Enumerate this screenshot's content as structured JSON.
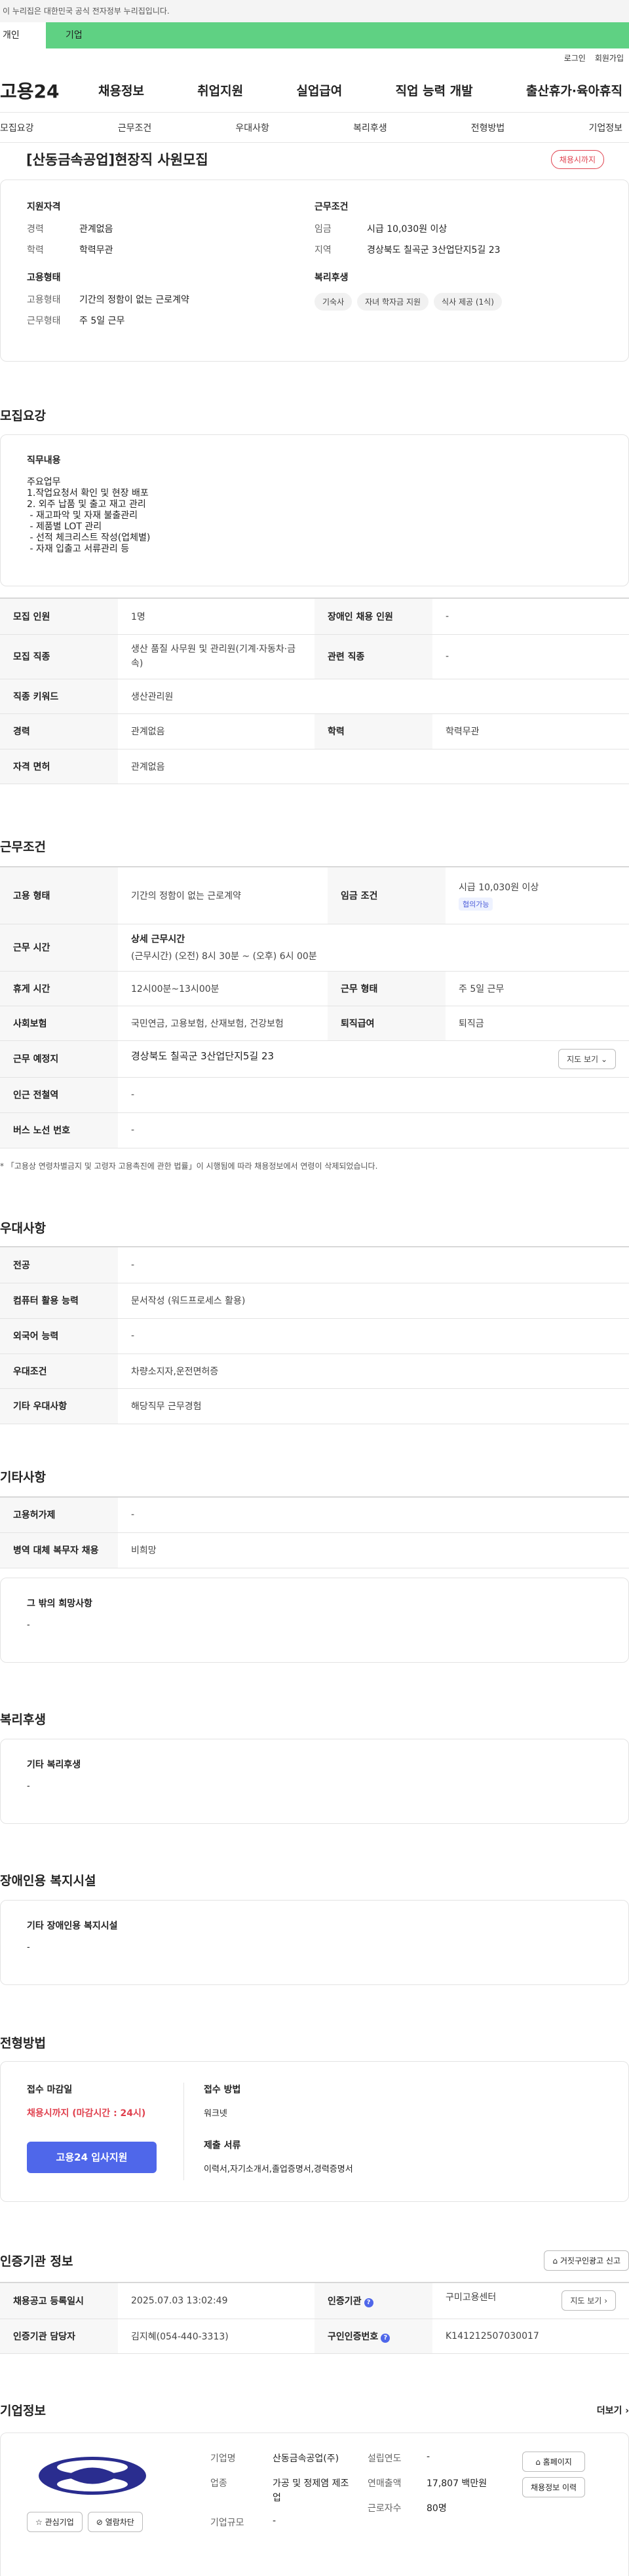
{
  "gov_banner": "이 누리집은 대한민국 공식 전자정부 누리집입니다.",
  "user_tabs": [
    "개인",
    "기업"
  ],
  "util": [
    "로그인",
    "회원가입"
  ],
  "logo": "고용24",
  "gnb": [
    "채용정보",
    "취업지원",
    "실업급여",
    "직업 능력 개발",
    "출산휴가·육아휴직"
  ],
  "anchor_tabs": [
    "모집요강",
    "근무조건",
    "우대사항",
    "복리후생",
    "전형방법",
    "기업정보"
  ],
  "summary": {
    "title": "[산동금속공업]현장직 사원모집",
    "badge": "채용시까지",
    "qual_title": "지원자격",
    "qual_rows": [
      {
        "k": "경력",
        "v": "관계없음"
      },
      {
        "k": "학력",
        "v": "학력무관"
      }
    ],
    "emp_title": "고용형태",
    "emp_rows": [
      {
        "k": "고용형태",
        "v": "기간의 정함이 없는 근로계약"
      },
      {
        "k": "근무형태",
        "v": "주 5일 근무"
      }
    ],
    "cond_title": "근무조건",
    "cond_rows": [
      {
        "k": "임금",
        "v": "시급 10,030원 이상"
      },
      {
        "k": "지역",
        "v": "경상북도 칠곡군 3산업단지5길 23"
      }
    ],
    "welfare_title": "복리후생",
    "welfare_chips": [
      "기숙사",
      "자녀 학자금 지원",
      "식사 제공 (1식)"
    ]
  },
  "recruit": {
    "title": "모집요강",
    "job_title": "직무내용",
    "job_text": "주요업무\n1.작업요청서 확인 및 현장 배포\n2. 외주 납품 및 출고 재고 관리\n - 재고파악 및 자재 불출관리\n - 제품별 LOT 관리\n - 선적 체크리스트 작성(업체별)\n - 자재 입출고 서류관리 등",
    "rows": [
      {
        "k1": "모집 인원",
        "v1": "1명",
        "k2": "장애인 채용 인원",
        "v2": "-"
      },
      {
        "k1": "모집 직종",
        "v1": "생산 품질 사무원 및 관리원(기계·자동차·금속)",
        "k2": "관련 직종",
        "v2": "-"
      },
      {
        "k1": "직종 키워드",
        "v1": "생산관리원"
      },
      {
        "k1": "경력",
        "v1": "관계없음",
        "k2": "학력",
        "v2": "학력무관"
      },
      {
        "k1": "자격 면허",
        "v1": "관계없음"
      }
    ]
  },
  "work": {
    "title": "근무조건",
    "emp_k": "고용 형태",
    "emp_v": "기간의 정함이 없는 근로계약",
    "wage_k": "임금 조건",
    "wage_v": "시급 10,030원 이상",
    "wage_tag": "협의가능",
    "hours_k": "근무 시간",
    "hours_title": "상세 근무시간",
    "hours_v": "(근무시간) (오전) 8시 30분 ~ (오후) 6시 00분",
    "rest_k": "휴게 시간",
    "rest_v": "12시00분~13시00분",
    "form_k": "근무 형태",
    "form_v": "주 5일 근무",
    "ins_k": "사회보험",
    "ins_v": "국민연금, 고용보험, 산재보험, 건강보험",
    "ret_k": "퇴직급여",
    "ret_v": "퇴직금",
    "place_k": "근무 예정지",
    "place_v": "경상북도 칠곡군 3산업단지5길 23",
    "map_btn": "지도 보기",
    "station_k": "인근 전철역",
    "station_v": "-",
    "bus_k": "버스 노선 번호",
    "bus_v": "-",
    "note": "* 「고용상 연령차별금지 및 고령자 고용촉진에 관한 법률」이 시행됨에 따라 채용정보에서 연령이 삭제되었습니다."
  },
  "pref": {
    "title": "우대사항",
    "rows": [
      {
        "k": "전공",
        "v": "-"
      },
      {
        "k": "컴퓨터 활용 능력",
        "v": "문서작성 (워드프로세스 활용)"
      },
      {
        "k": "외국어 능력",
        "v": "-"
      },
      {
        "k": "우대조건",
        "v": "차량소지자,운전면허증"
      },
      {
        "k": "기타 우대사항",
        "v": "해당직무 근무경험"
      }
    ]
  },
  "etc": {
    "title": "기타사항",
    "rows": [
      {
        "k": "고용허가제",
        "v": "-"
      },
      {
        "k": "병역 대체 복무자 채용",
        "v": "비희망"
      }
    ],
    "other_title": "그 밖의 희망사항",
    "other_v": "-"
  },
  "welfare": {
    "title": "복리후생",
    "box_title": "기타 복리후생",
    "box_v": "-"
  },
  "disabled": {
    "title": "장애인용 복지시설",
    "box_title": "기타 장애인용 복지시설",
    "box_v": "-"
  },
  "process": {
    "title": "전형방법",
    "deadline_title": "접수 마감일",
    "deadline_v": "채용시까지 (마감시간 : 24시)",
    "apply_btn": "고용24 입사지원",
    "method_title": "접수 방법",
    "method_v": "워크넷",
    "docs_title": "제출 서류",
    "docs_v": "이력서,자기소개서,졸업증명서,경력증명서"
  },
  "agency": {
    "title": "인증기관 정보",
    "report_btn": "거짓구인광고 신고",
    "reg_k": "채용공고 등록일시",
    "reg_v": "2025.07.03 13:02:49",
    "org_k": "인증기관",
    "org_v": "구미고용센터",
    "map_btn": "지도 보기",
    "staff_k": "인증기관 담당자",
    "staff_v": "김지혜(054-440-3313)",
    "num_k": "구인인증번호",
    "num_v": "K141212507030017"
  },
  "company": {
    "title": "기업정보",
    "more": "더보기",
    "fav_btn": "관심기업",
    "block_btn": "열람차단",
    "name_k": "기업명",
    "name_v": "산동금속공업(주)",
    "industry_k": "업종",
    "industry_v": "가공 및 정제염 제조업",
    "size_k": "기업규모",
    "size_v": "-",
    "founded_k": "설립연도",
    "founded_v": "-",
    "sales_k": "연매출액",
    "sales_v": "17,807 백만원",
    "emp_k": "근로자수",
    "emp_v": "80명",
    "home_btn": "홈페이지",
    "history_btn": "채용정보 이력"
  }
}
